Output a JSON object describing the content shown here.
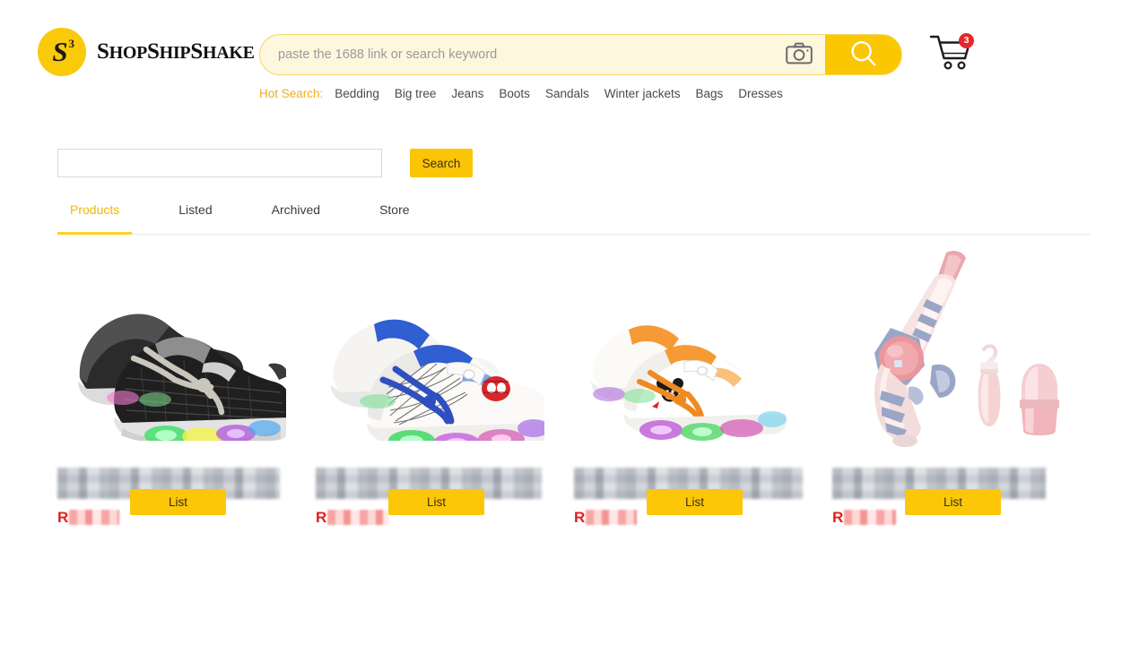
{
  "brand": {
    "logo_letter": "S",
    "logo_superscript": "3",
    "name_part1_cap": "S",
    "name_part1": "HOP",
    "name_part2_cap": "S",
    "name_part2": "HIP",
    "name_part3_cap": "S",
    "name_part3": "HAKE",
    "logo_bg": "#f9ca0a"
  },
  "search": {
    "placeholder": "paste the 1688 link or search keyword",
    "value": "",
    "camera_icon": "camera-icon",
    "submit_icon": "magnifier-icon",
    "button_color": "#fbc700"
  },
  "cart": {
    "icon": "shopping-cart-icon",
    "badge_count": "3",
    "badge_color": "#e8262a"
  },
  "hot_search": {
    "label": "Hot Search:",
    "label_color": "#f0ac1b",
    "items": [
      "Bedding",
      "Big tree",
      "Jeans",
      "Boots",
      "Sandals",
      "Winter jackets",
      "Bags",
      "Dresses"
    ]
  },
  "filter": {
    "input_value": "",
    "input_placeholder": "",
    "search_label": "Search",
    "search_color": "#fbc505"
  },
  "tabs": {
    "active_color": "#f3b700",
    "items": [
      {
        "label": "Products",
        "active": true
      },
      {
        "label": "Listed",
        "active": false
      },
      {
        "label": "Archived",
        "active": false
      },
      {
        "label": "Store",
        "active": false
      }
    ]
  },
  "products": [
    {
      "image_alt": "black-led-sneakers",
      "title_redacted": true,
      "title_mask_width": 248,
      "price_currency": "R",
      "price_redacted": true,
      "price_mask_width": 56,
      "list_label": "List"
    },
    {
      "image_alt": "spiderman-white-blue-led-sneakers",
      "title_redacted": true,
      "title_mask_width": 252,
      "price_currency": "R",
      "price_redacted": true,
      "price_mask_width": 68,
      "list_label": "List"
    },
    {
      "image_alt": "mickey-white-orange-led-sneakers",
      "title_redacted": true,
      "title_mask_width": 255,
      "price_currency": "R",
      "price_redacted": true,
      "price_mask_width": 57,
      "list_label": "List"
    },
    {
      "image_alt": "pink-bubble-gun-toy-set",
      "title_redacted": true,
      "title_mask_width": 238,
      "price_currency": "R",
      "price_redacted": true,
      "price_mask_width": 58,
      "list_label": "List"
    }
  ]
}
